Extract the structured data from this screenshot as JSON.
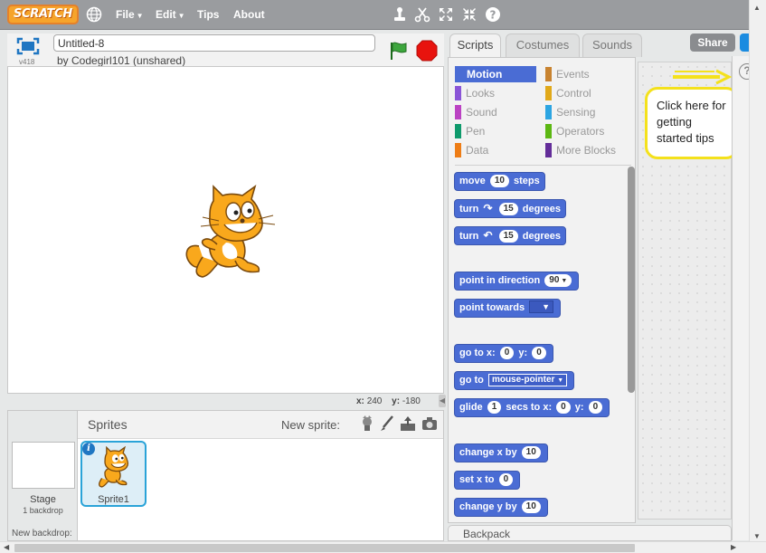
{
  "topbar": {
    "logo": "SCRATCH",
    "menus": [
      "File",
      "Edit",
      "Tips",
      "About"
    ],
    "icons": [
      "globe-icon",
      "duplicate-stamp-icon",
      "cut-scissors-icon",
      "grow-icon",
      "shrink-icon",
      "help-question-icon"
    ]
  },
  "project": {
    "title": "Untitled-8",
    "byline": "by Codegirl101 (unshared)",
    "version": "v418"
  },
  "stage": {
    "coords_x_label": "x:",
    "coords_x": "240",
    "coords_y_label": "y:",
    "coords_y": "-180"
  },
  "tabs": [
    "Scripts",
    "Costumes",
    "Sounds"
  ],
  "share_label": "Share",
  "categories": [
    {
      "label": "Motion",
      "color": "#4a6cd4",
      "active": true
    },
    {
      "label": "Events",
      "color": "#c88330"
    },
    {
      "label": "Looks",
      "color": "#8a55d7"
    },
    {
      "label": "Control",
      "color": "#e1a91a"
    },
    {
      "label": "Sound",
      "color": "#bb42c3"
    },
    {
      "label": "Sensing",
      "color": "#2ca5e2"
    },
    {
      "label": "Pen",
      "color": "#0e9a6c"
    },
    {
      "label": "Operators",
      "color": "#5cb712"
    },
    {
      "label": "Data",
      "color": "#ee7d16"
    },
    {
      "label": "More Blocks",
      "color": "#632d99"
    }
  ],
  "blocks": {
    "move": {
      "a": "move",
      "v": "10",
      "b": "steps"
    },
    "turn_cw": {
      "a": "turn",
      "v": "15",
      "b": "degrees"
    },
    "turn_ccw": {
      "a": "turn",
      "v": "15",
      "b": "degrees"
    },
    "point_dir": {
      "a": "point in direction",
      "v": "90"
    },
    "point_towards": {
      "a": "point towards"
    },
    "goto_xy": {
      "a": "go to x:",
      "v1": "0",
      "b": "y:",
      "v2": "0"
    },
    "goto": {
      "a": "go to",
      "v": "mouse-pointer"
    },
    "glide": {
      "a": "glide",
      "v1": "1",
      "b": "secs to x:",
      "v2": "0",
      "c": "y:",
      "v3": "0"
    },
    "change_x": {
      "a": "change x by",
      "v": "10"
    },
    "set_x": {
      "a": "set x to",
      "v": "0"
    },
    "change_y": {
      "a": "change y by",
      "v": "10"
    }
  },
  "tip": {
    "line1": "Click here for",
    "line2": "getting",
    "line3": "started tips"
  },
  "backpack_label": "Backpack",
  "sprites_pane": {
    "header": "Sprites",
    "new_sprite_label": "New sprite:",
    "stage_label": "Stage",
    "backdrop_count": "1 backdrop",
    "new_backdrop_label": "New backdrop:",
    "sprites": [
      {
        "name": "Sprite1"
      }
    ]
  }
}
